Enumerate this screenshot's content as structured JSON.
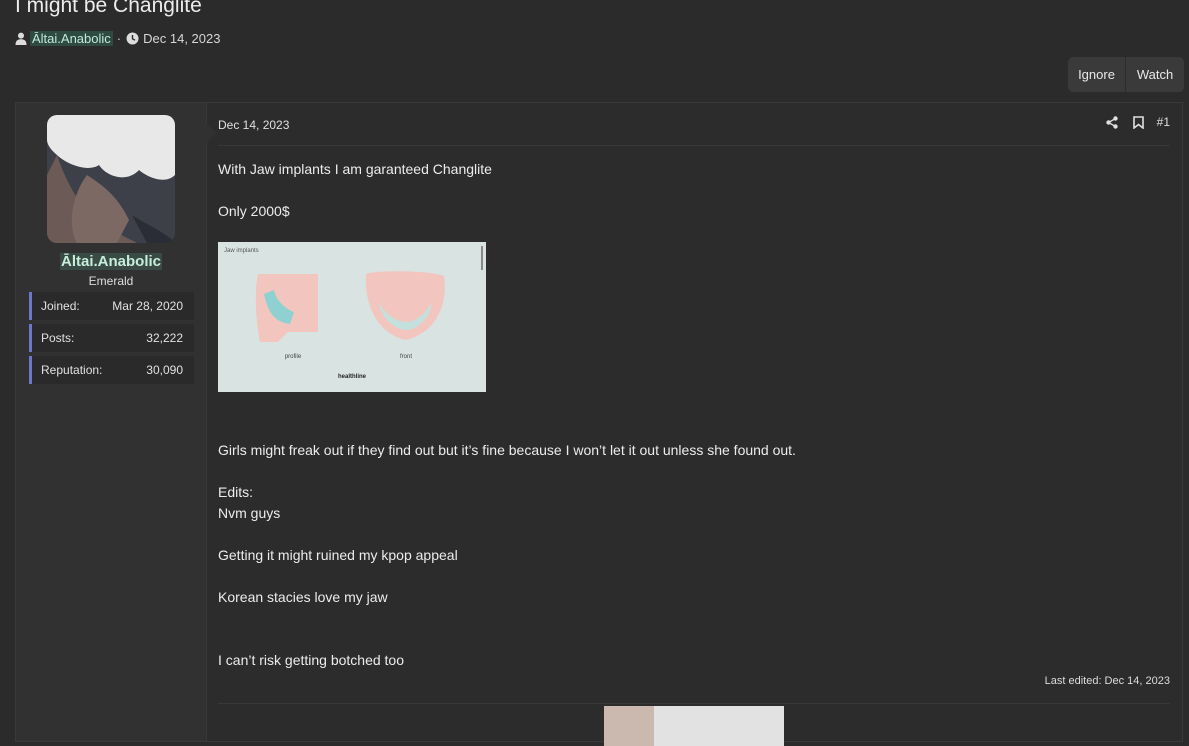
{
  "thread": {
    "title": "I might be Changlite",
    "author": "Āltai.Anabolic",
    "date": "Dec 14, 2023",
    "separator": "·"
  },
  "actions": {
    "ignore_label": "Ignore",
    "watch_label": "Watch"
  },
  "user": {
    "name": "Āltai.Anabolic",
    "title": "Emerald",
    "stats": [
      {
        "label": "Joined:",
        "value": "Mar 28, 2020"
      },
      {
        "label": "Posts:",
        "value": "32,222"
      },
      {
        "label": "Reputation:",
        "value": "30,090"
      }
    ]
  },
  "post": {
    "date": "Dec 14, 2023",
    "number": "#1",
    "lines": [
      "With Jaw implants I am garanteed Changlite",
      "Only 2000$",
      "Girls might freak out if they find out but it’s fine because I won’t let it out unless she found out.",
      "Edits:",
      "Nvm guys",
      "Getting it might ruined my kpop appeal",
      "Korean stacies love my jaw",
      "I can’t risk getting botched too"
    ],
    "attachment": {
      "caption": "Jaw implants",
      "label_profile": "profile",
      "label_front": "front",
      "brand": "healthline"
    },
    "last_edited": "Last edited: Dec 14, 2023"
  },
  "icons": [
    "user-icon",
    "clock-icon",
    "share-icon",
    "bookmark-icon"
  ],
  "colors": {
    "background": "#2b2b2b",
    "username_accent": "#c7eedb",
    "stat_border": "#6b78c9"
  }
}
